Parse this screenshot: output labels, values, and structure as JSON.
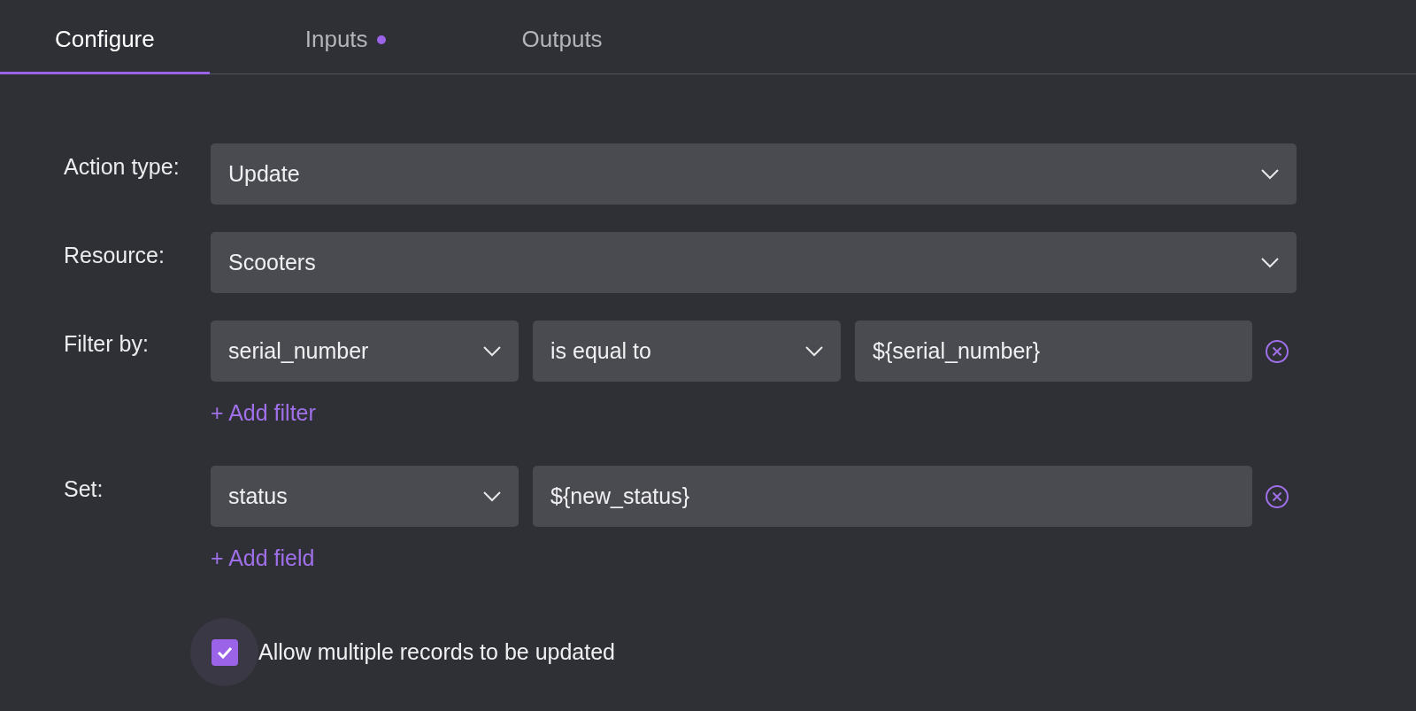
{
  "tabs": [
    {
      "label": "Configure",
      "selected": true,
      "dot": false
    },
    {
      "label": "Inputs",
      "selected": false,
      "dot": true
    },
    {
      "label": "Outputs",
      "selected": false,
      "dot": false
    }
  ],
  "rows": [
    {
      "label": "Action type:",
      "removable": false,
      "controls": [
        {
          "kind": "select",
          "value": "Update"
        }
      ]
    },
    {
      "label": "Resource:",
      "removable": false,
      "controls": [
        {
          "kind": "select",
          "value": "Scooters"
        }
      ]
    },
    {
      "label": "Filter by:",
      "removable": true,
      "add_link": "+ Add filter",
      "controls": [
        {
          "kind": "select",
          "value": "serial_number"
        },
        {
          "kind": "select",
          "value": "is equal to"
        },
        {
          "kind": "input",
          "value": "${serial_number}"
        }
      ]
    },
    {
      "label": "Set:",
      "removable": true,
      "add_link": "+ Add field",
      "controls": [
        {
          "kind": "select",
          "value": "status"
        },
        {
          "kind": "input",
          "value": "${new_status}"
        }
      ]
    }
  ],
  "checkbox": {
    "label": "Allow multiple records to be updated",
    "checked": true
  }
}
